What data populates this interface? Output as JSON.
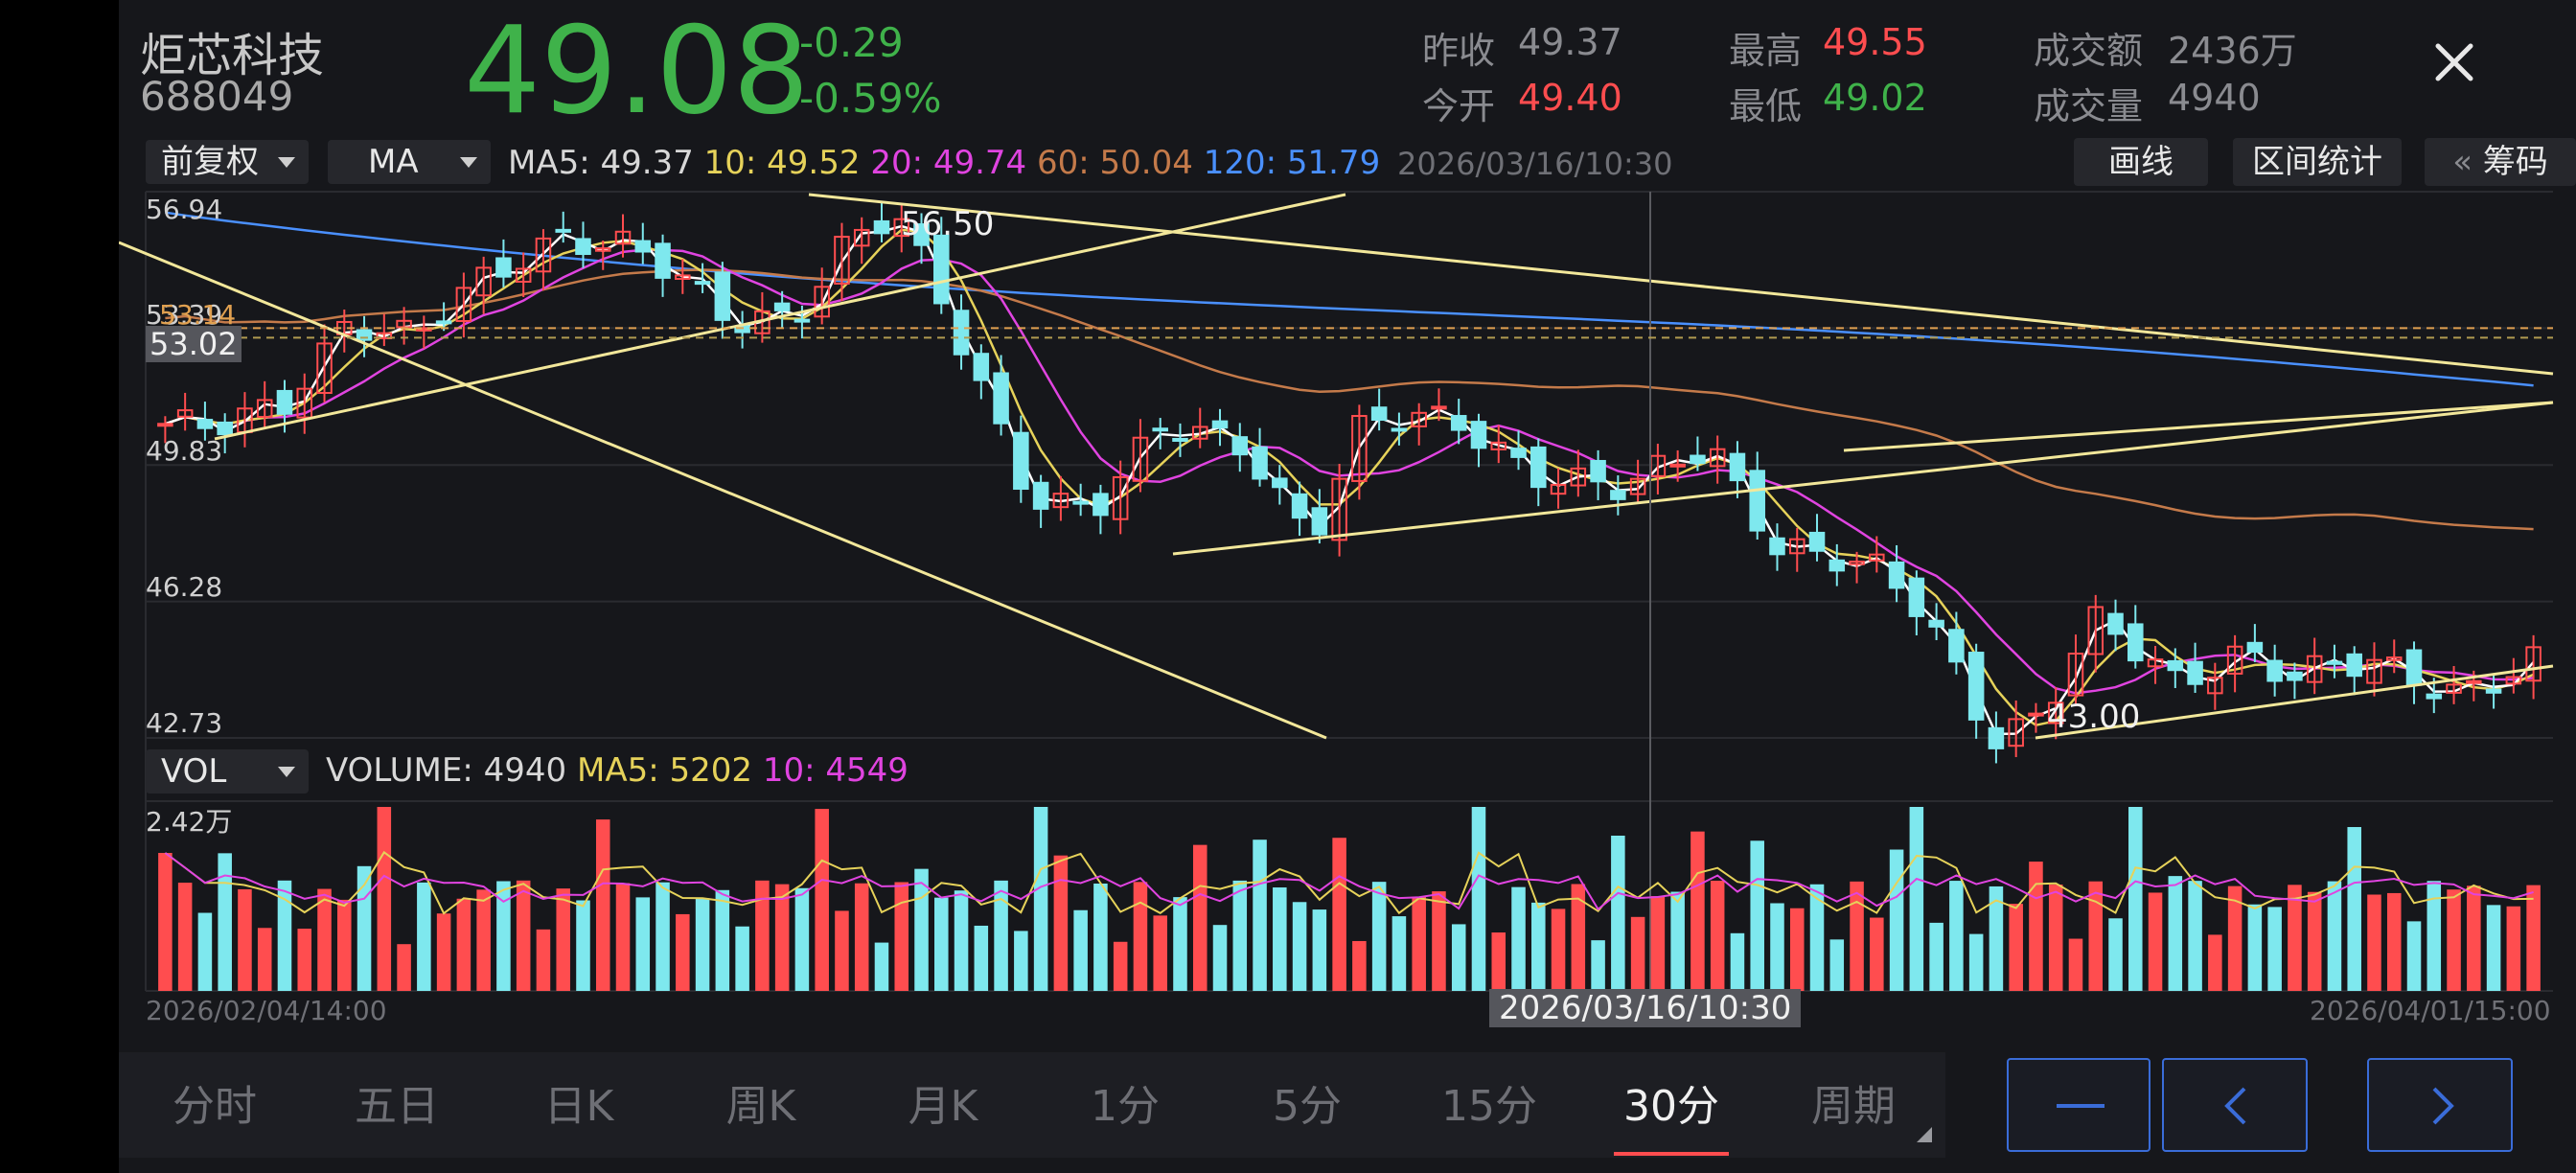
{
  "stock": {
    "name": "炬芯科技",
    "code": "688049",
    "price": "49.08",
    "change": "-0.29",
    "change_pct": "-0.59%"
  },
  "stats": {
    "prev_close_label": "昨收",
    "prev_close": "49.37",
    "open_label": "今开",
    "open": "49.40",
    "high_label": "最高",
    "high": "49.55",
    "low_label": "最低",
    "low": "49.02",
    "amount_label": "成交额",
    "amount": "2436万",
    "volume_label": "成交量",
    "volume": "4940"
  },
  "toolbar": {
    "adjust": "前复权",
    "indicator": "MA",
    "ma5": "MA5: 49.37",
    "ma10": "10: 49.52",
    "ma20": "20: 49.74",
    "ma60": "60: 50.04",
    "ma120": "120: 51.79",
    "cursor_time": "2026/03/16/10:30",
    "draw_label": "画线",
    "range_label": "区间统计",
    "chips_arrow": "«",
    "chips_label": "筹码"
  },
  "price_axis": {
    "top": "56.94",
    "l2": "53.39",
    "l2_overlap": "53.14",
    "cursor_price": "53.02",
    "l3": "49.83",
    "l4": "46.28",
    "bottom": "42.73"
  },
  "annotations": {
    "peak": "56.50",
    "trough": "43.00"
  },
  "volume_bar": {
    "indicator": "VOL",
    "volume": "VOLUME: 4940",
    "ma5": "MA5: 5202",
    "ma10": "10: 4549",
    "axis_top": "2.42万"
  },
  "time_axis": {
    "start": "2026/02/04/14:00",
    "cursor": "2026/03/16/10:30",
    "end": "2026/04/01/15:00"
  },
  "tabs": [
    "分时",
    "五日",
    "日K",
    "周K",
    "月K",
    "1分",
    "5分",
    "15分",
    "30分",
    "周期"
  ],
  "active_tab": "30分",
  "colors": {
    "up": "#ff4d4f",
    "down": "#7ee8ee",
    "ma5": "#ffffff",
    "ma10": "#e6d25a",
    "ma20": "#e044e0",
    "ma60": "#c47a4a",
    "ma120": "#4a90ff",
    "trendline": "#f2e79a"
  },
  "icons": {
    "close": "close-icon",
    "minus": "minus-icon",
    "prev": "chevron-left-icon",
    "next": "chevron-right-icon"
  }
}
